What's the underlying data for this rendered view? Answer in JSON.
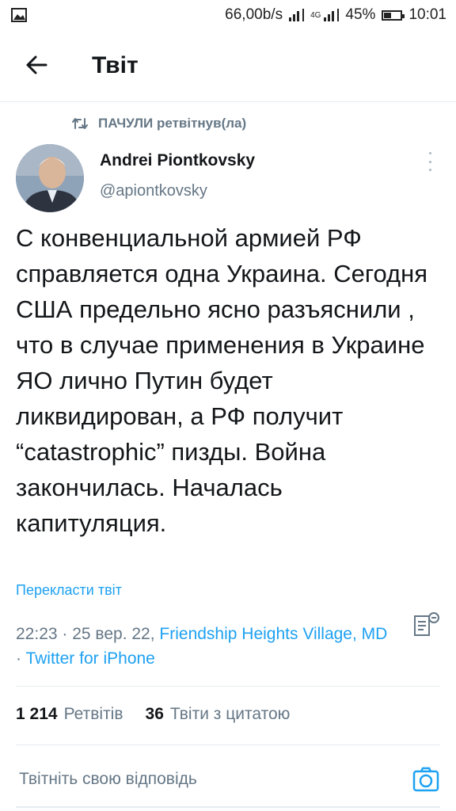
{
  "status_bar": {
    "network_speed": "66,00b/s",
    "network_type": "4G",
    "battery": "45%",
    "battery_level": 0.45,
    "time": "10:01"
  },
  "header": {
    "title": "Твіт"
  },
  "retweet_context": {
    "user": "ПАЧУЛИ",
    "action": "ретвітнув(ла)"
  },
  "author": {
    "name": "Andrei Piontkovsky",
    "handle": "@apiontkovsky"
  },
  "tweet": {
    "text": "С конвенциальной армией РФ справляется одна Украина. Сегодня США предельно ясно разъяснили , что в случае применения в Украине ЯО лично Путин будет ликвидирован, а РФ получит “catastrophic” пизды. Война закончилась. Началась капитуляция.",
    "translate_label": "Перекласти твіт",
    "time": "22:23",
    "date": "25 вер. 22",
    "location": "Friendship Heights Village, MD",
    "source": "Twitter for iPhone"
  },
  "stats": {
    "retweets_count": "1 214",
    "retweets_label": "Ретвітів",
    "quotes_count": "36",
    "quotes_label": "Твіти з цитатою"
  },
  "reply": {
    "placeholder": "Твітніть свою відповідь"
  },
  "colors": {
    "accent": "#1da1f2",
    "secondary_text": "#657786",
    "divider": "#e6ecf0"
  },
  "icons": [
    "image-icon",
    "signal-icon",
    "battery-icon",
    "back-arrow-icon",
    "retweet-icon",
    "more-options-icon",
    "analytics-icon",
    "camera-icon"
  ]
}
